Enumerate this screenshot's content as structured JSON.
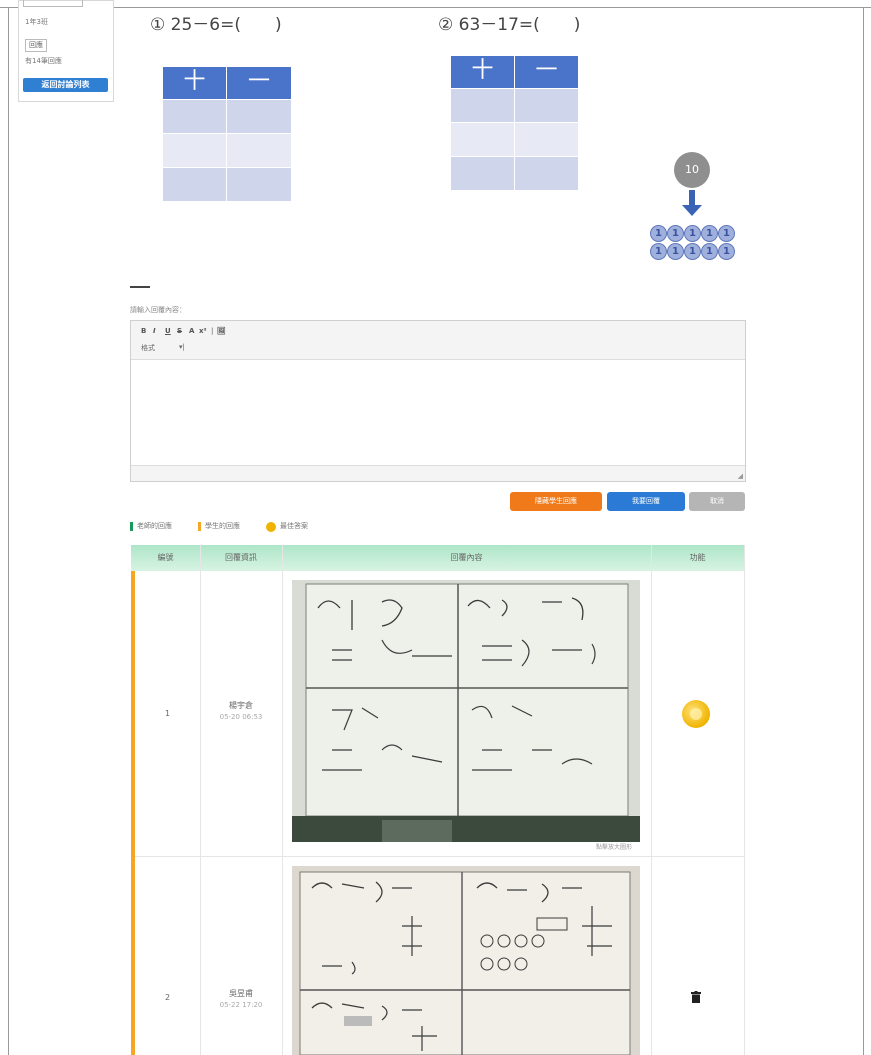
{
  "sidebar": {
    "class_label": "1年3班",
    "reply_box": "回應",
    "reply_count": "有14筆回應",
    "back_button": "返回討論列表"
  },
  "problems": [
    {
      "text": "① 25－6=(　　)",
      "headers": [
        "十",
        "一"
      ]
    },
    {
      "text": "② 63－17=(　　)",
      "headers": [
        "十",
        "一"
      ]
    }
  ],
  "ten_diagram": {
    "top": "10",
    "ones": [
      "1",
      "1",
      "1",
      "1",
      "1",
      "1",
      "1",
      "1",
      "1",
      "1"
    ]
  },
  "editor": {
    "prompt": "請輸入回覆內容：",
    "toolbar": [
      "B",
      "I",
      "U",
      "S",
      "A",
      "x²",
      "|",
      "🖼"
    ],
    "format_label": "格式"
  },
  "actions": {
    "hide_replies": "隱藏學生回應",
    "submit": "我要回覆",
    "cancel": "取消"
  },
  "legend": [
    {
      "label": "老師的回應",
      "color": "#1a9a5a"
    },
    {
      "label": "學生的回應",
      "color": "#f5a623"
    },
    {
      "label": "最佳答案",
      "color": "#f0b400"
    }
  ],
  "table": {
    "headers": [
      "編號",
      "回覆資訊",
      "回覆內容",
      "功能"
    ],
    "rows": [
      {
        "num": "1",
        "name": "楊宇倉",
        "time": "05-20 06:53",
        "caption": "點擊放大圖形",
        "action": "medal-icon"
      },
      {
        "num": "2",
        "name": "吳昱甫",
        "time": "05-22 17:20",
        "caption": "",
        "action": "trash-icon"
      }
    ]
  }
}
